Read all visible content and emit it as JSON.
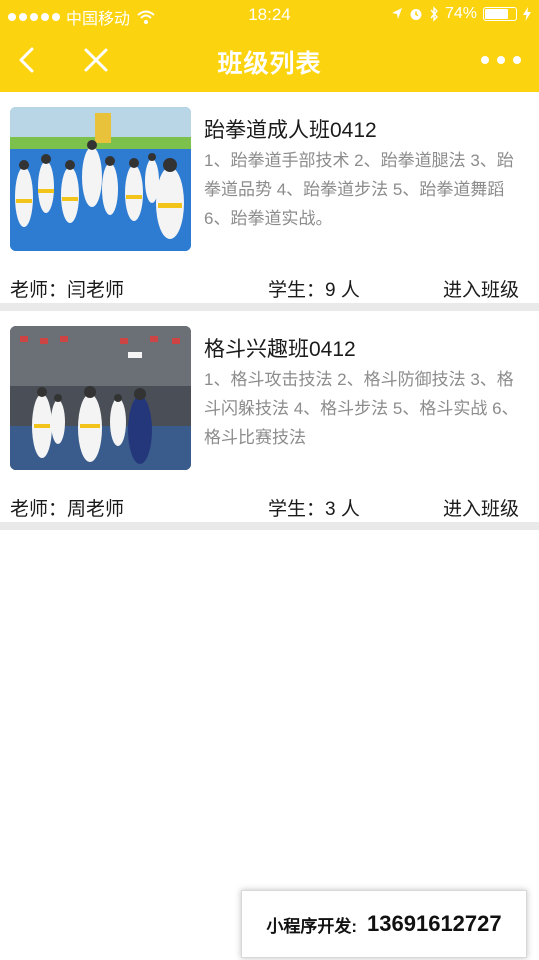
{
  "status_bar": {
    "carrier": "中国移动",
    "time": "18:24",
    "battery": "74%"
  },
  "nav": {
    "title": "班级列表"
  },
  "classes": [
    {
      "name": "跆拳道成人班0412",
      "description": "1、跆拳道手部技术 2、跆拳道腿法 3、跆拳道品势 4、跆拳道步法 5、跆拳道舞蹈 6、跆拳道实战。",
      "teacher": "老师：闫老师",
      "students": "学生：9 人",
      "enter_label": "进入班级"
    },
    {
      "name": "格斗兴趣班0412",
      "description": "1、格斗攻击技法 2、格斗防御技法 3、格斗闪躲技法 4、格斗步法 5、格斗实战 6、格斗比赛技法",
      "teacher": "老师：周老师",
      "students": "学生：3 人",
      "enter_label": "进入班级"
    }
  ],
  "promo": {
    "label": "小程序开发:",
    "phone": "13691612727"
  },
  "colors": {
    "accent": "#fcd30f",
    "divider": "#e9e9e9",
    "muted_text": "#8c8c8c"
  },
  "icons": [
    "signal-dots-icon",
    "wifi-icon",
    "location-icon",
    "alarm-icon",
    "bluetooth-icon",
    "battery-icon",
    "back-icon",
    "close-icon",
    "more-icon"
  ]
}
